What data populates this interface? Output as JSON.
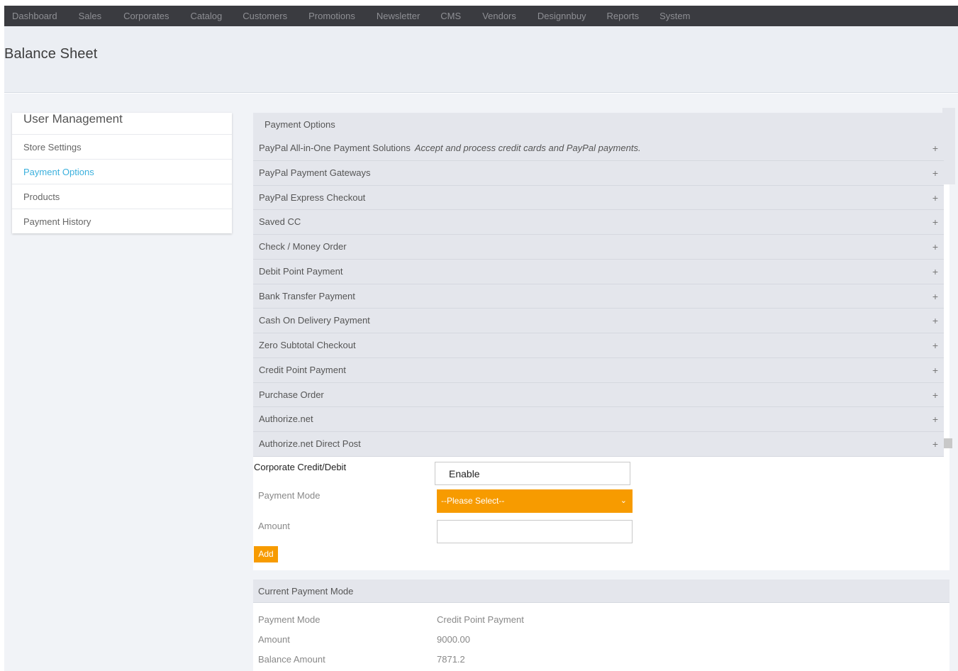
{
  "topnav": {
    "items": [
      "Dashboard",
      "Sales",
      "Corporates",
      "Catalog",
      "Customers",
      "Promotions",
      "Newsletter",
      "CMS",
      "Vendors",
      "Designnbuy",
      "Reports",
      "System"
    ]
  },
  "page": {
    "title": "Balance Sheet"
  },
  "sidebar": {
    "title": "User Management",
    "items": [
      {
        "label": "Store Settings",
        "active": false
      },
      {
        "label": "Payment Options",
        "active": true
      },
      {
        "label": "Products",
        "active": false
      },
      {
        "label": "Payment History",
        "active": false
      }
    ]
  },
  "payment_options": {
    "header": "Payment Options",
    "rows": [
      {
        "label": "PayPal All-in-One Payment Solutions",
        "desc": "Accept and process credit cards and PayPal payments."
      },
      {
        "label": "PayPal Payment Gateways"
      },
      {
        "label": "PayPal Express Checkout"
      },
      {
        "label": "Saved CC"
      },
      {
        "label": "Check / Money Order"
      },
      {
        "label": "Debit Point Payment"
      },
      {
        "label": "Bank Transfer Payment"
      },
      {
        "label": "Cash On Delivery Payment"
      },
      {
        "label": "Zero Subtotal Checkout"
      },
      {
        "label": "Credit Point Payment"
      },
      {
        "label": "Purchase Order"
      },
      {
        "label": "Authorize.net"
      },
      {
        "label": "Authorize.net Direct Post"
      }
    ],
    "expand_glyph": "+"
  },
  "corporate_form": {
    "title": "Corporate Credit/Debit",
    "enable_value": "Enable",
    "payment_mode_label": "Payment Mode",
    "payment_mode_selected": "--Please Select--",
    "amount_label": "Amount",
    "amount_value": "",
    "add_label": "Add"
  },
  "current_payment": {
    "header": "Current Payment Mode",
    "payment_mode_label": "Payment Mode",
    "payment_mode_value": "Credit Point Payment",
    "amount_label": "Amount",
    "amount_value": "9000.00",
    "balance_label": "Balance Amount",
    "balance_value": "7871.2"
  },
  "colors": {
    "accent_orange": "#f79b00",
    "active_link": "#3bb0dd",
    "nav_bg": "#3a3b40"
  }
}
